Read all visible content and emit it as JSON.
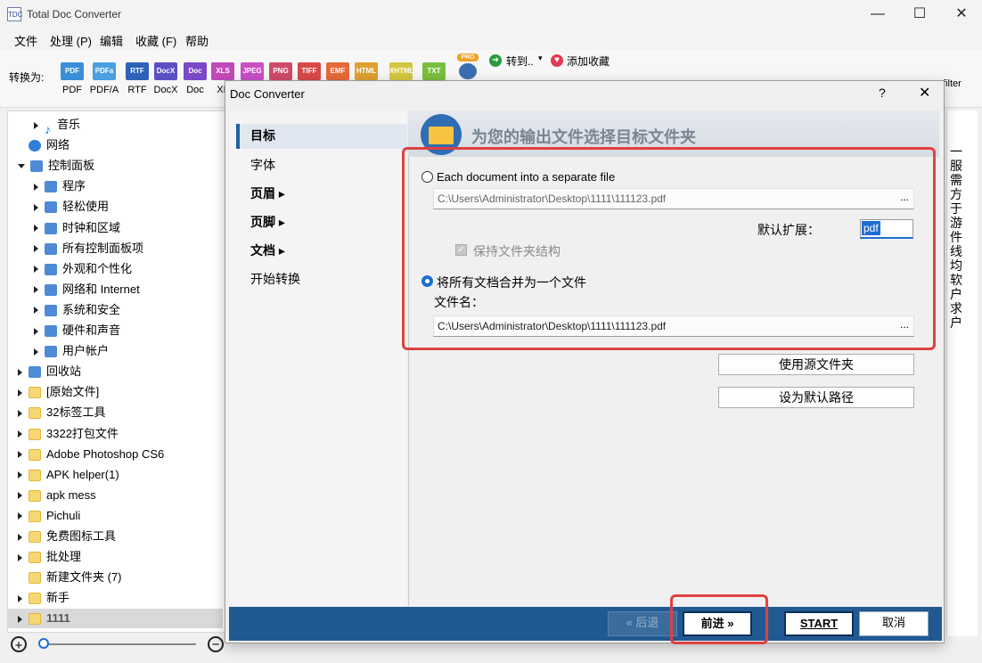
{
  "window": {
    "title": "Total Doc Converter",
    "minimize": "—",
    "maximize": "☐",
    "close": "✕"
  },
  "menu": [
    "文件",
    "处理 (P)",
    "编辑",
    "收藏 (F)",
    "帮助"
  ],
  "toolbar": {
    "convert_to": "转换为:",
    "formats": [
      {
        "icon": "PDF",
        "label": "PDF",
        "color": "#3a8fd8"
      },
      {
        "icon": "PDFa",
        "label": "PDF/A",
        "color": "#4a9fe0"
      },
      {
        "icon": "RTF",
        "label": "RTF",
        "color": "#2e62b8"
      },
      {
        "icon": "DocX",
        "label": "DocX",
        "color": "#5b4fc4"
      },
      {
        "icon": "Doc",
        "label": "Doc",
        "color": "#7a48c8"
      },
      {
        "icon": "XLS",
        "label": "XL",
        "color": "#c04ab8"
      },
      {
        "icon": "JPEG",
        "label": "",
        "color": "#c94fc6"
      },
      {
        "icon": "PNG",
        "label": "",
        "color": "#d04a6a"
      },
      {
        "icon": "TIFF",
        "label": "",
        "color": "#d84a4a"
      },
      {
        "icon": "EMF",
        "label": "",
        "color": "#e86a3a"
      },
      {
        "icon": "HTML",
        "label": "",
        "color": "#e0a030"
      },
      {
        "icon": "XHTML",
        "label": "",
        "color": "#d4c840"
      },
      {
        "icon": "TXT",
        "label": "",
        "color": "#7ac040"
      }
    ],
    "pro_badge": "PRO",
    "goto": "转到..",
    "favorite": "添加收藏",
    "filter": "filter"
  },
  "tree": [
    {
      "label": "音乐",
      "indent": 1,
      "expand": "right",
      "icon": "note"
    },
    {
      "label": "网络",
      "indent": 0,
      "expand": "none",
      "icon": "net"
    },
    {
      "label": "控制面板",
      "indent": 0,
      "expand": "down",
      "icon": "cp"
    },
    {
      "label": "程序",
      "indent": 1,
      "expand": "right",
      "icon": "cp"
    },
    {
      "label": "轻松使用",
      "indent": 1,
      "expand": "right",
      "icon": "cp"
    },
    {
      "label": "时钟和区域",
      "indent": 1,
      "expand": "right",
      "icon": "cp"
    },
    {
      "label": "所有控制面板项",
      "indent": 1,
      "expand": "right",
      "icon": "cp"
    },
    {
      "label": "外观和个性化",
      "indent": 1,
      "expand": "right",
      "icon": "cp"
    },
    {
      "label": "网络和 Internet",
      "indent": 1,
      "expand": "right",
      "icon": "cp"
    },
    {
      "label": "系统和安全",
      "indent": 1,
      "expand": "right",
      "icon": "cp"
    },
    {
      "label": "硬件和声音",
      "indent": 1,
      "expand": "right",
      "icon": "cp"
    },
    {
      "label": "用户帐户",
      "indent": 1,
      "expand": "right",
      "icon": "cp"
    },
    {
      "label": "回收站",
      "indent": 0,
      "expand": "right",
      "icon": "cp"
    },
    {
      "label": "[原始文件]",
      "indent": 0,
      "expand": "right",
      "icon": "folder"
    },
    {
      "label": "32标签工具",
      "indent": 0,
      "expand": "right",
      "icon": "folder"
    },
    {
      "label": "3322打包文件",
      "indent": 0,
      "expand": "right",
      "icon": "folder"
    },
    {
      "label": "Adobe Photoshop CS6",
      "indent": 0,
      "expand": "right",
      "icon": "folder"
    },
    {
      "label": "APK helper(1)",
      "indent": 0,
      "expand": "right",
      "icon": "folder"
    },
    {
      "label": "apk mess",
      "indent": 0,
      "expand": "right",
      "icon": "folder"
    },
    {
      "label": "Pichuli",
      "indent": 0,
      "expand": "right",
      "icon": "folder"
    },
    {
      "label": "免费图标工具",
      "indent": 0,
      "expand": "right",
      "icon": "folder"
    },
    {
      "label": "批处理",
      "indent": 0,
      "expand": "right",
      "icon": "folder"
    },
    {
      "label": "新建文件夹 (7)",
      "indent": 0,
      "expand": "none",
      "icon": "folder"
    },
    {
      "label": "新手",
      "indent": 0,
      "expand": "right",
      "icon": "folder"
    },
    {
      "label": "1111",
      "indent": 0,
      "expand": "right",
      "icon": "folder"
    }
  ],
  "right_vertical_text": "一服需方于游件线均软户求户",
  "dialog": {
    "title": "Doc Converter",
    "help": "?",
    "close": "✕",
    "nav": [
      {
        "label": "目标",
        "arrow": ""
      },
      {
        "label": "字体",
        "arrow": ""
      },
      {
        "label": "页眉",
        "arrow": "▸"
      },
      {
        "label": "页脚",
        "arrow": "▸"
      },
      {
        "label": "文档",
        "arrow": "▸"
      },
      {
        "label": "开始转换",
        "arrow": ""
      }
    ],
    "banner": "为您的输出文件选择目标文件夹",
    "option_separate": "Each document into a separate file",
    "separate_path": "C:\\Users\\Administrator\\Desktop\\1111\\111123.pdf",
    "default_ext_label": "默认扩展：",
    "default_ext_value": "pdf",
    "keep_structure": "保持文件夹结构",
    "option_merge": "将所有文档合并为一个文件",
    "filename_label": "文件名：",
    "merge_path": "C:\\Users\\Administrator\\Desktop\\1111\\111123.pdf",
    "browse": "...",
    "use_source": "使用源文件夹",
    "set_default": "设为默认路径",
    "back": "« 后退",
    "next": "前进 »",
    "start": "START",
    "cancel": "取消"
  }
}
